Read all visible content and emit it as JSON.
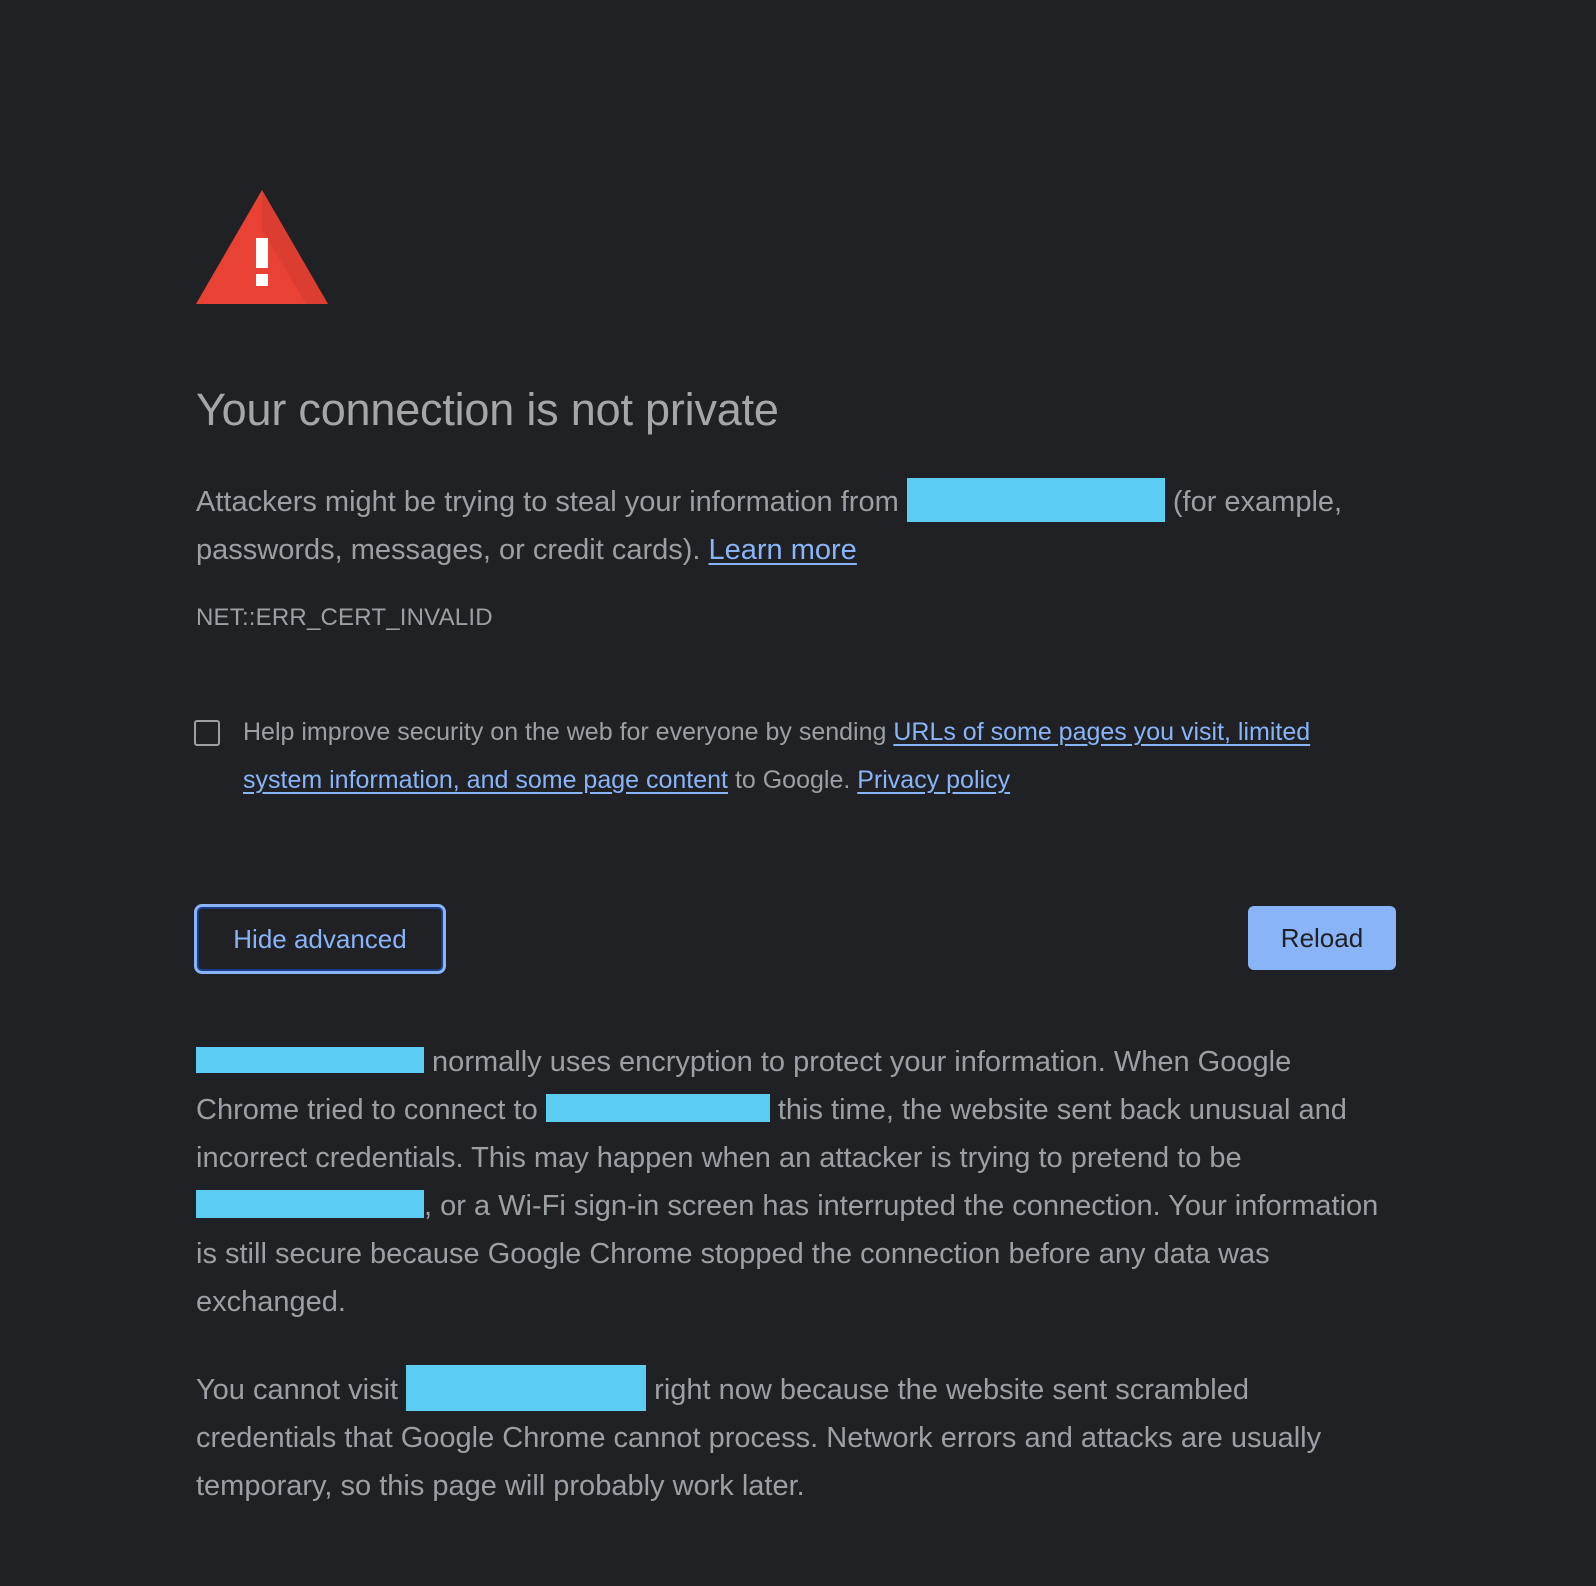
{
  "page": {
    "title": "Your connection is not private",
    "attack": {
      "before": "Attackers might be trying to steal your information from ",
      "after": " (for example, passwords, messages, or credit cards). ",
      "learn_more": "Learn more"
    },
    "error_code": "NET::ERR_CERT_INVALID",
    "optin": {
      "before": "Help improve security on the web for everyone by sending ",
      "link": "URLs of some pages you visit, limited system information, and some page content",
      "middle": " to Google. ",
      "privacy": "Privacy policy"
    },
    "buttons": {
      "hide_advanced": "Hide advanced",
      "reload": "Reload"
    },
    "details": {
      "s1": " normally uses encryption to protect your information. When Google Chrome tried to connect to ",
      "s2": " this time, the website sent back unusual and incorrect credentials. This may happen when an attacker is trying to pretend to be ",
      "s3": ", or a Wi-Fi sign-in screen has interrupted the connection. Your information is still secure because Google Chrome stopped the connection before any data was exchanged."
    },
    "cannot": {
      "before": "You cannot visit ",
      "after": " right now because the website sent scrambled credentials that Google Chrome cannot process. Network errors and attacks are usually temporary, so this page will probably work later."
    }
  },
  "colors": {
    "background": "#202124",
    "text": "#9aa0a6",
    "link": "#8ab4f8",
    "warning": "#e94235",
    "redaction": "#5bcdf2"
  }
}
